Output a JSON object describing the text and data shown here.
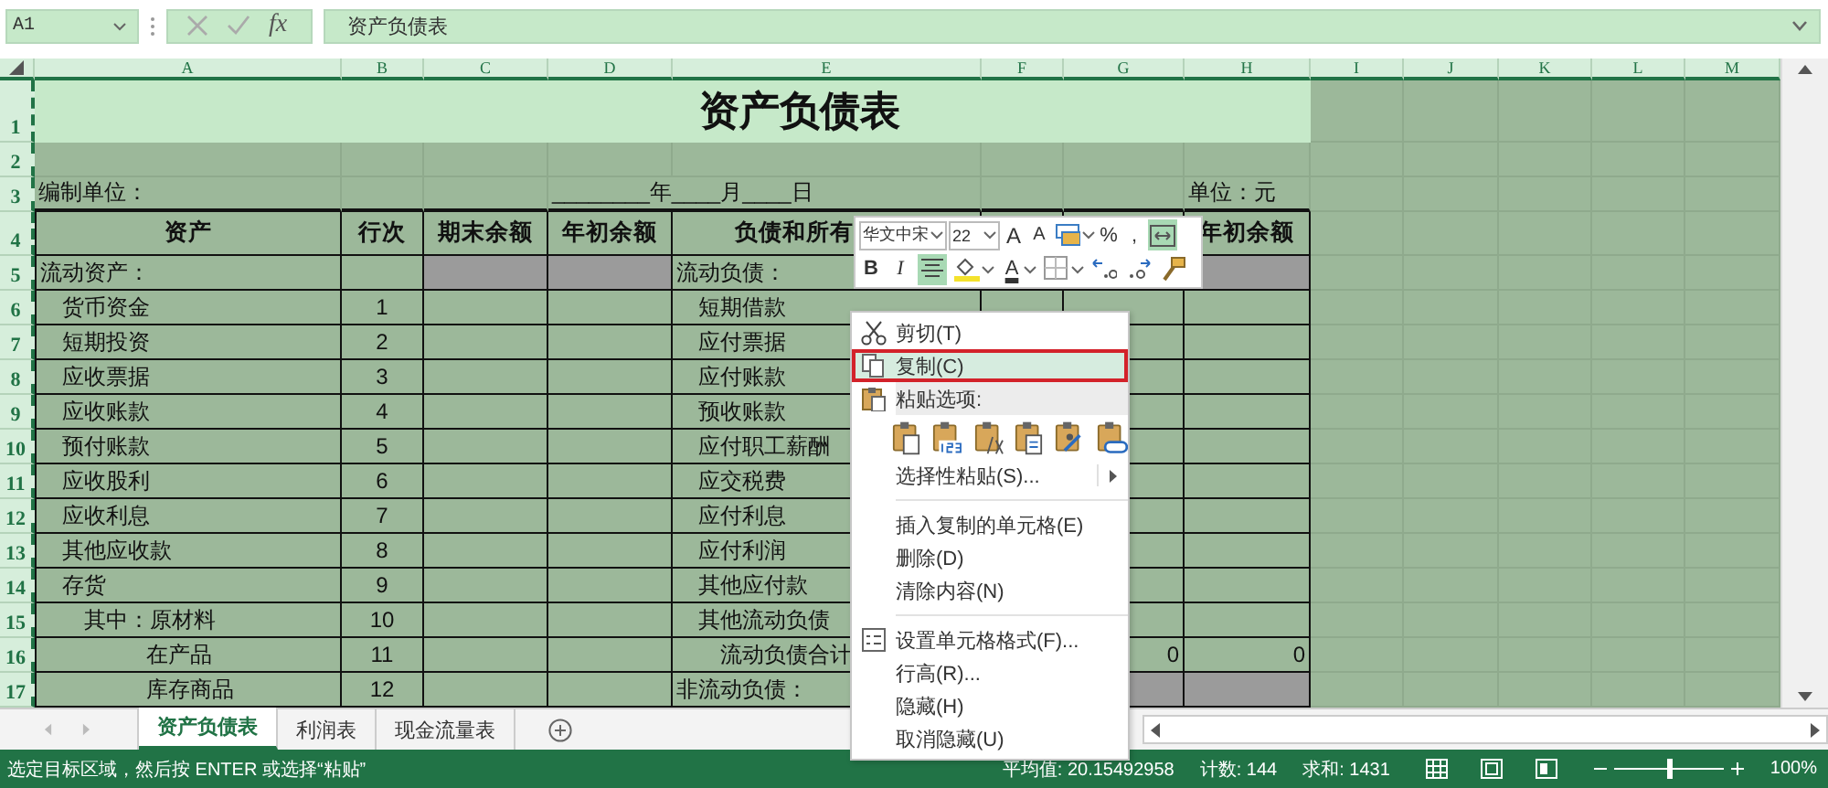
{
  "formula_bar": {
    "name_box": "A1",
    "function_label": "fx",
    "formula": "资产负债表"
  },
  "columns": [
    "A",
    "B",
    "C",
    "D",
    "E",
    "F",
    "G",
    "H",
    "I",
    "J",
    "K",
    "L",
    "M"
  ],
  "rows": [
    {
      "number": "1",
      "kind": "title",
      "cells": {
        "A": {
          "kind": "title",
          "text": "资产负债表"
        }
      }
    },
    {
      "number": "2",
      "kind": "blank"
    },
    {
      "number": "3",
      "kind": "info",
      "cells": {
        "A": {
          "kind": "plain",
          "text": "编制单位："
        },
        "D": {
          "kind": "date",
          "text": "________年____月____日"
        },
        "H": {
          "kind": "plain",
          "text": "单位：元"
        }
      }
    },
    {
      "number": "4",
      "kind": "table",
      "cells": {
        "A": {
          "kind": "header",
          "text": "资产"
        },
        "B": {
          "kind": "header",
          "text": "行次"
        },
        "C": {
          "kind": "header",
          "text": "期末余额"
        },
        "D": {
          "kind": "header",
          "text": "年初余额"
        },
        "E": {
          "kind": "header_cut",
          "text": "负债和所有"
        },
        "H": {
          "kind": "header",
          "text": "年初余额"
        }
      }
    },
    {
      "number": "5",
      "kind": "table",
      "cells": {
        "A": {
          "kind": "plain",
          "text": "流动资产："
        },
        "C": {
          "kind": "shaded"
        },
        "D": {
          "kind": "shaded"
        },
        "E": {
          "kind": "plain",
          "text": "流动负债："
        },
        "H": {
          "kind": "shaded"
        }
      }
    },
    {
      "number": "6",
      "kind": "table",
      "cells": {
        "A": {
          "kind": "item",
          "text": "货币资金"
        },
        "B": {
          "kind": "number",
          "text": "1"
        },
        "E": {
          "kind": "item",
          "text": "短期借款"
        }
      }
    },
    {
      "number": "7",
      "kind": "table",
      "cells": {
        "A": {
          "kind": "item",
          "text": "短期投资"
        },
        "B": {
          "kind": "number",
          "text": "2"
        },
        "E": {
          "kind": "item",
          "text": "应付票据"
        }
      }
    },
    {
      "number": "8",
      "kind": "table",
      "cells": {
        "A": {
          "kind": "item",
          "text": "应收票据"
        },
        "B": {
          "kind": "number",
          "text": "3"
        },
        "E": {
          "kind": "item",
          "text": "应付账款"
        }
      }
    },
    {
      "number": "9",
      "kind": "table",
      "cells": {
        "A": {
          "kind": "item",
          "text": "应收账款"
        },
        "B": {
          "kind": "number",
          "text": "4"
        },
        "E": {
          "kind": "item",
          "text": "预收账款"
        }
      }
    },
    {
      "number": "10",
      "kind": "table",
      "cells": {
        "A": {
          "kind": "item",
          "text": "预付账款"
        },
        "B": {
          "kind": "number",
          "text": "5"
        },
        "E": {
          "kind": "item",
          "text": "应付职工薪酬"
        }
      }
    },
    {
      "number": "11",
      "kind": "table",
      "cells": {
        "A": {
          "kind": "item",
          "text": "应收股利"
        },
        "B": {
          "kind": "number",
          "text": "6"
        },
        "E": {
          "kind": "item",
          "text": "应交税费"
        }
      }
    },
    {
      "number": "12",
      "kind": "table",
      "cells": {
        "A": {
          "kind": "item",
          "text": "应收利息"
        },
        "B": {
          "kind": "number",
          "text": "7"
        },
        "E": {
          "kind": "item",
          "text": "应付利息"
        }
      }
    },
    {
      "number": "13",
      "kind": "table",
      "cells": {
        "A": {
          "kind": "item",
          "text": "其他应收款"
        },
        "B": {
          "kind": "number",
          "text": "8"
        },
        "E": {
          "kind": "item",
          "text": "应付利润"
        }
      }
    },
    {
      "number": "14",
      "kind": "table",
      "cells": {
        "A": {
          "kind": "item",
          "text": "存货"
        },
        "B": {
          "kind": "number",
          "text": "9"
        },
        "E": {
          "kind": "item",
          "text": "其他应付款"
        }
      }
    },
    {
      "number": "15",
      "kind": "table",
      "cells": {
        "A": {
          "kind": "sub",
          "text": "其中：原材料"
        },
        "B": {
          "kind": "number",
          "text": "10"
        },
        "E": {
          "kind": "item",
          "text": "其他流动负债"
        }
      }
    },
    {
      "number": "16",
      "kind": "table",
      "cells": {
        "A": {
          "kind": "subsub",
          "text": "在产品"
        },
        "B": {
          "kind": "number",
          "text": "11"
        },
        "E": {
          "kind": "sub",
          "text": "流动负债合计"
        },
        "G": {
          "kind": "value",
          "text": "0"
        },
        "H": {
          "kind": "value",
          "text": "0"
        }
      }
    },
    {
      "number": "17",
      "kind": "table",
      "cells": {
        "A": {
          "kind": "subsub",
          "text": "库存商品"
        },
        "B": {
          "kind": "number",
          "text": "12"
        },
        "E": {
          "kind": "plain",
          "text": "非流动负债："
        },
        "G": {
          "kind": "shaded"
        },
        "H": {
          "kind": "shaded"
        }
      }
    }
  ],
  "mini_toolbar": {
    "font": "华文中宋",
    "size": "22",
    "top_buttons": [
      {
        "kind": "grow",
        "label": "A",
        "selected": false
      },
      {
        "kind": "shrink",
        "label": "A",
        "selected": false
      },
      {
        "kind": "styles",
        "selected": false
      },
      {
        "kind": "text",
        "label": "%",
        "selected": false
      },
      {
        "kind": "text",
        "label": ",",
        "selected": false
      },
      {
        "kind": "merge",
        "selected": true
      }
    ],
    "bottom_buttons": [
      {
        "kind": "bold",
        "label": "B",
        "selected": false
      },
      {
        "kind": "italic",
        "label": "I",
        "selected": false
      },
      {
        "kind": "center",
        "selected": true
      },
      {
        "kind": "fill",
        "selected": false
      },
      {
        "kind": "font_color",
        "label": "A",
        "selected": false
      },
      {
        "kind": "borders",
        "selected": false
      },
      {
        "kind": "inc_decimal",
        "selected": false
      },
      {
        "kind": "dec_decimal",
        "selected": false
      },
      {
        "kind": "painter",
        "selected": false
      }
    ]
  },
  "context_menu": {
    "items": [
      {
        "kind": "cut",
        "text": "剪切(T)",
        "selected": false,
        "outlined": false
      },
      {
        "kind": "copy",
        "text": "复制(C)",
        "selected": true,
        "outlined": true
      },
      {
        "kind": "paste_header",
        "text": "粘贴选项:"
      },
      {
        "kind": "paste_options"
      },
      {
        "kind": "submenu",
        "text": "选择性粘贴(S)...",
        "selected": false,
        "outlined": false
      },
      {
        "kind": "separator"
      },
      {
        "kind": "command",
        "text": "插入复制的单元格(E)",
        "selected": false,
        "outlined": false
      },
      {
        "kind": "command",
        "text": "删除(D)",
        "selected": false,
        "outlined": false
      },
      {
        "kind": "command",
        "text": "清除内容(N)",
        "selected": false,
        "outlined": false
      },
      {
        "kind": "separator"
      },
      {
        "kind": "format",
        "text": "设置单元格格式(F)...",
        "selected": false,
        "outlined": false
      },
      {
        "kind": "command",
        "text": "行高(R)...",
        "selected": false,
        "outlined": false
      },
      {
        "kind": "command",
        "text": "隐藏(H)",
        "selected": false,
        "outlined": false
      },
      {
        "kind": "command",
        "text": "取消隐藏(U)",
        "selected": false,
        "outlined": false
      }
    ]
  },
  "tabs": [
    {
      "label": "资产负债表",
      "selected": true
    },
    {
      "label": "利润表",
      "selected": false
    },
    {
      "label": "现金流量表",
      "selected": false
    }
  ],
  "status_bar": {
    "message": "选定目标区域，然后按 ENTER 或选择“粘贴”",
    "average": "平均值: 20.15492958",
    "count": "计数: 144",
    "sum": "求和: 1431",
    "zoom_slider": {
      "level": 0.5
    },
    "zoom": "100%"
  }
}
